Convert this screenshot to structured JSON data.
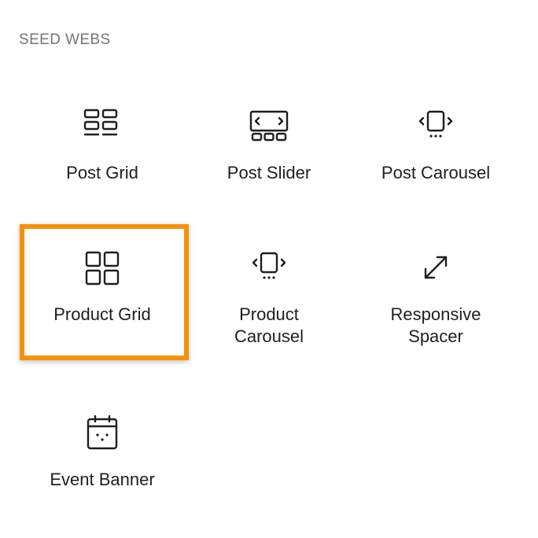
{
  "section": {
    "title": "SEED WEBS"
  },
  "blocks": [
    {
      "label": "Post Grid",
      "icon": "post-grid-icon"
    },
    {
      "label": "Post Slider",
      "icon": "post-slider-icon"
    },
    {
      "label": "Post Carousel",
      "icon": "post-carousel-icon"
    },
    {
      "label": "Product Grid",
      "icon": "product-grid-icon",
      "highlighted": true
    },
    {
      "label": "Product\nCarousel",
      "icon": "product-carousel-icon"
    },
    {
      "label": "Responsive\nSpacer",
      "icon": "responsive-spacer-icon"
    },
    {
      "label": "Event Banner",
      "icon": "calendar-icon"
    }
  ],
  "colors": {
    "highlight": "#f7910a",
    "heading": "#757575",
    "text": "#1e1e1e"
  }
}
